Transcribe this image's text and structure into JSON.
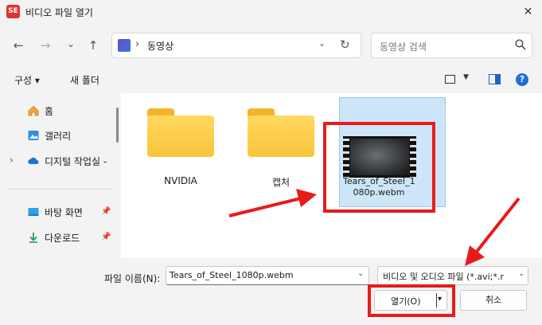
{
  "window": {
    "title": "비디오 파일 열기",
    "app_icon": "SE",
    "close": "✕"
  },
  "nav": {
    "back_icon": "←",
    "forward_icon": "→",
    "recent_icon": "⌄",
    "up_icon": "↑",
    "address_sep": "›",
    "address_text": "동영상",
    "address_dropdown": "⌄",
    "refresh_icon": "↻",
    "search_placeholder": "동영상 검색"
  },
  "toolbar": {
    "organize": "구성 ▾",
    "new_folder": "새 폴더",
    "view_dropdown": "▼",
    "help": "?"
  },
  "sidebar": {
    "items": [
      {
        "label": "홈",
        "icon": "home-icon"
      },
      {
        "label": "갤러리",
        "icon": "gallery-icon"
      },
      {
        "label": "디지털 작업실 -",
        "icon": "cloud-icon"
      },
      {
        "label": "바탕 화면",
        "icon": "desktop-icon"
      },
      {
        "label": "다운로드",
        "icon": "download-icon"
      }
    ],
    "expand_chevron": "›",
    "pin": "📌"
  },
  "content": {
    "items": [
      {
        "label": "NVIDIA",
        "type": "folder"
      },
      {
        "label": "캡처",
        "type": "folder"
      },
      {
        "label": "Tears_of_Steel_1080p.webm",
        "label_line1": "Tears_of_Steel_1",
        "label_line2": "080p.webm",
        "type": "video",
        "selected": true
      }
    ]
  },
  "bottom": {
    "filename_label": "파일 이름(N):",
    "filename_value": "Tears_of_Steel_1080p.webm",
    "filter_value": "비디오 및 오디오 파일 (*.avi;*.r",
    "dropdown_arrow": "⌄",
    "open_label": "열기(O)",
    "open_dropdown": "▾",
    "cancel_label": "취소"
  },
  "colors": {
    "annotation_red": "#e81b1b",
    "selection_fill": "#cde6f7",
    "folder_yellow": "#f9c43b",
    "accent_blue": "#1e6fd9"
  }
}
